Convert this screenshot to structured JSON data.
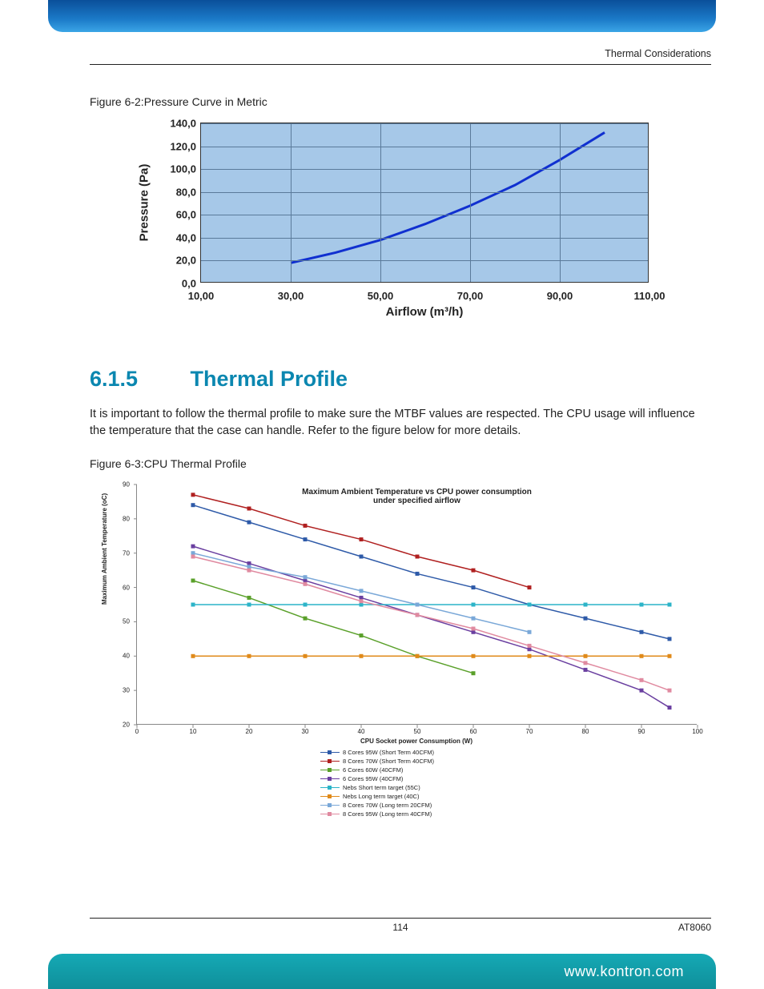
{
  "header": {
    "running_head": "Thermal Considerations"
  },
  "figure_6_2": {
    "label": "Figure 6-2:Pressure Curve in Metric"
  },
  "section": {
    "number": "6.1.5",
    "title": "Thermal Profile",
    "body": "It is important to follow the thermal profile to make sure the MTBF values are respected. The CPU usage will influence the temperature that the case can handle. Refer to the figure below for more details."
  },
  "figure_6_3": {
    "label": "Figure 6-3:CPU Thermal Profile"
  },
  "footer": {
    "page": "114",
    "doc": "AT8060",
    "url": "www.kontron.com"
  },
  "chart_data": [
    {
      "type": "line",
      "title": "",
      "xlabel": "Airflow (m³/h)",
      "ylabel": "Pressure (Pa)",
      "xlim": [
        10,
        110
      ],
      "ylim": [
        0,
        140
      ],
      "x_ticks": [
        "10,00",
        "30,00",
        "50,00",
        "70,00",
        "90,00",
        "110,00"
      ],
      "y_ticks": [
        "0,0",
        "20,0",
        "40,0",
        "60,0",
        "80,0",
        "100,0",
        "120,0",
        "140,0"
      ],
      "series": [
        {
          "name": "Pressure",
          "color": "#1030d0",
          "x": [
            30,
            40,
            50,
            60,
            70,
            80,
            90,
            100
          ],
          "y": [
            18,
            27,
            38,
            52,
            68,
            86,
            108,
            132
          ]
        }
      ]
    },
    {
      "type": "line",
      "title": "Maximum Ambient Temperature vs CPU power consumption under specified airflow",
      "xlabel": "CPU Socket power Consumption (W)",
      "ylabel": "Maximum Ambient Temperature (oC)",
      "xlim": [
        0,
        100
      ],
      "ylim": [
        20,
        90
      ],
      "x_ticks": [
        "0",
        "10",
        "20",
        "30",
        "40",
        "50",
        "60",
        "70",
        "80",
        "90",
        "100"
      ],
      "y_ticks": [
        "20",
        "30",
        "40",
        "50",
        "60",
        "70",
        "80",
        "90"
      ],
      "series": [
        {
          "name": "8 Cores 95W (Short Term 40CFM)",
          "color": "#2e5aa8",
          "marker": "diamond",
          "x": [
            10,
            20,
            30,
            40,
            50,
            60,
            70,
            80,
            90,
            95
          ],
          "y": [
            84,
            79,
            74,
            69,
            64,
            60,
            55,
            51,
            47,
            45
          ]
        },
        {
          "name": "8 Cores 70W (Short Term 40CFM)",
          "color": "#b02020",
          "marker": "square",
          "x": [
            10,
            20,
            30,
            40,
            50,
            60,
            70
          ],
          "y": [
            87,
            83,
            78,
            74,
            69,
            65,
            60
          ]
        },
        {
          "name": "6 Cores 60W (40CFM)",
          "color": "#5aa02a",
          "marker": "triangle",
          "x": [
            10,
            20,
            30,
            40,
            50,
            60
          ],
          "y": [
            62,
            57,
            51,
            46,
            40,
            35
          ]
        },
        {
          "name": "6 Cores 95W (40CFM)",
          "color": "#6a3fa0",
          "marker": "x",
          "x": [
            10,
            20,
            30,
            40,
            50,
            60,
            70,
            80,
            90,
            95
          ],
          "y": [
            72,
            67,
            62,
            57,
            52,
            47,
            42,
            36,
            30,
            25
          ]
        },
        {
          "name": "Nebs Short term target (55C)",
          "color": "#2cb4c8",
          "marker": "star",
          "x": [
            10,
            20,
            30,
            40,
            50,
            60,
            70,
            80,
            90,
            95
          ],
          "y": [
            55,
            55,
            55,
            55,
            55,
            55,
            55,
            55,
            55,
            55
          ]
        },
        {
          "name": "Nebs Long term target (40C)",
          "color": "#e08a1a",
          "marker": "circle",
          "x": [
            10,
            20,
            30,
            40,
            50,
            60,
            70,
            80,
            90,
            95
          ],
          "y": [
            40,
            40,
            40,
            40,
            40,
            40,
            40,
            40,
            40,
            40
          ]
        },
        {
          "name": "8 Cores 70W (Long term 20CFM)",
          "color": "#7aa8d8",
          "marker": "plus",
          "x": [
            10,
            20,
            30,
            40,
            50,
            60,
            70
          ],
          "y": [
            70,
            66,
            63,
            59,
            55,
            51,
            47
          ]
        },
        {
          "name": "8 Cores 95W (Long term 40CFM)",
          "color": "#e08aa0",
          "marker": "dash",
          "x": [
            10,
            20,
            30,
            40,
            50,
            60,
            70,
            80,
            90,
            95
          ],
          "y": [
            69,
            65,
            61,
            56,
            52,
            48,
            43,
            38,
            33,
            30
          ]
        }
      ]
    }
  ]
}
